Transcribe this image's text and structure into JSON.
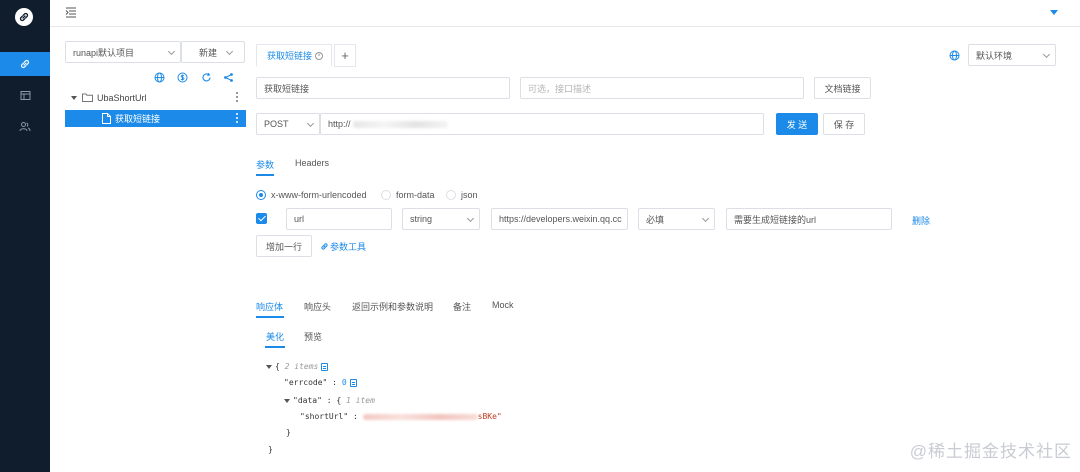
{
  "colors": {
    "rail_bg": "#0f1d2c",
    "accent": "#1b8ae8",
    "json_string": "#c23b22"
  },
  "rail": {
    "icons": [
      "link-logo-icon",
      "link-icon",
      "window-icon",
      "users-icon"
    ]
  },
  "sidebar": {
    "project_select": "runapi默认项目",
    "new_button": "新建",
    "toolbar_icons": [
      "globe-icon",
      "dollar-icon",
      "refresh-icon",
      "share-icon"
    ],
    "tree": {
      "folder": "UbaShortUrl",
      "item": "获取短链接"
    }
  },
  "main": {
    "tab_title": "获取短链接",
    "add_tab": "+",
    "environment": "默认环境",
    "name_value": "获取短链接",
    "desc_placeholder": "可选，接口描述",
    "doc_link_button": "文档链接",
    "method": "POST",
    "url_prefix": "http://",
    "send_button": "发 送",
    "save_button": "保 存",
    "request_tabs": {
      "params": "参数",
      "headers": "Headers"
    },
    "body_types": {
      "urlencoded": "x-www-form-urlencoded",
      "formdata": "form-data",
      "json": "json",
      "selected": "x-www-form-urlencoded"
    },
    "param_row": {
      "checked": true,
      "key": "url",
      "type": "string",
      "value": "https://developers.weixin.qq.cc",
      "required": "必填",
      "description": "需要生成短链接的url",
      "delete": "删除"
    },
    "add_row_button": "增加一行",
    "param_tool_link": "参数工具",
    "response_tabs": {
      "body": "响应体",
      "headers": "响应头",
      "examples": "返回示例和参数说明",
      "notes": "备注",
      "mock": "Mock"
    },
    "view_tabs": {
      "pretty": "美化",
      "preview": "预览"
    },
    "json": {
      "open_brace": "{",
      "root_meta": "2 items",
      "errcode_key": "\"errcode\"",
      "colon": " : ",
      "errcode_value": "0",
      "data_key": "\"data\"",
      "data_open": "{",
      "data_meta": "1 item",
      "short_url_key": "\"shortUrl\"",
      "short_url_tail": "sBKe\"",
      "close_inner": "}",
      "close_outer": "}"
    }
  },
  "watermark": "@稀土掘金技术社区"
}
